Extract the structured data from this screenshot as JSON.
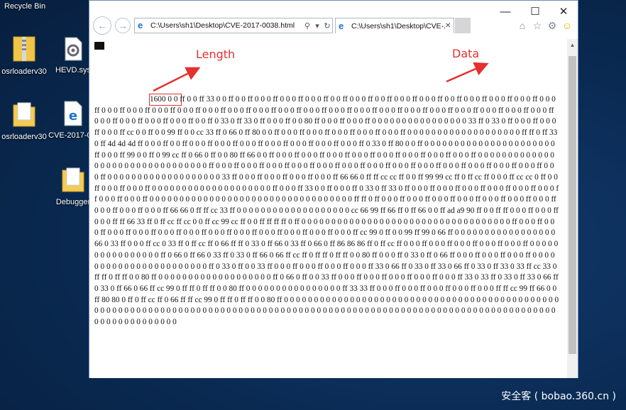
{
  "desktop": {
    "recycle_bin": "Recycle Bin",
    "icons": [
      {
        "label": "osrloaderv30",
        "icon": "zip-folder-icon"
      },
      {
        "label": "HEVD.sys",
        "icon": "system-file-icon"
      },
      {
        "label": "osrloaderv30",
        "icon": "folder-icon"
      },
      {
        "label": "CVE-2017-0...",
        "icon": "ie-file-icon"
      },
      {
        "label": "Debugger",
        "icon": "folder-icon"
      }
    ],
    "watermark": "安全客 ( bobao.360.cn )"
  },
  "browser": {
    "address": "C:\\Users\\sh1\\Desktop\\CVE-2017-0038.html",
    "tab_title": "C:\\Users\\sh1\\Desktop\\CVE-...",
    "window_controls": {
      "minimize": "—",
      "maximize": "☐",
      "close": "✕"
    },
    "toolbar_icons": [
      "home-icon",
      "favorites-star-icon",
      "settings-gear-icon",
      "feedback-smiley-icon"
    ]
  },
  "annotations": {
    "length_label": "Length",
    "data_label": "Data",
    "color": "#e5302c"
  },
  "dump": {
    "length_value": "1600",
    "text": "0 0 ff 0 0 ff 33 0 0 ff 0 0 ff 0 0 0 ff 0 0 0 ff 0 0 0 ff 0 0 ff 0 0 0 ff 0 0 ff 0 0 0 ff 0 0 0 ff 0 0 ff 0 0 0 ff 0 0 0 ff 0 0 0 ff 0 0 0 ff 0 0 0 ff 0 0 0 ff 0 0 0 ff 0 0 0 ff 0 0 0 ff 0 0 0 ff 0 0 0 ff 0 0 0 ff 0 0 0 ff 0 0 0 ff 0 0 0 ff 0 0 0 ff 0 0 0 ff 0 0 0 ff 0 0 0 ff 0 0 0 ff 0 0 0 ff 0 0 0 ff 0 0 0 ff 0 0 0 ff 0 0 0 ff 0 0 0 ff 0 0 ff 0 33 0 ff 33 0 ff 0 0 0 ff 0 0 80 ff 0 0 0 ff 0 0 0 ff 0 0 0 0 0 0 0 0 0 0 0 0 0 0 0 0 33 ff 0 33 0 ff 0 0 0 ff 0 0 0 ff 0 0 0 ff cc 0 0 ff 0 0 99 ff 0 0 cc 33 ff 0 66 0 ff 80 0 0 ff 0 0 0 ff 0 0 0 ff 0 0 0 ff 0 0 0 ff 0 0 0 ff 0 0 0 0 0 0 0 0 0 0 0 0 0 0 0 0 0 0 0 ff ff 0 ff 33 0 ff 4d 4d 4d ff 0 0 0 ff 0 0 ff 0 0 0 ff 0 0 0 ff 0 0 0 ff 0 0 0 ff 0 0 0 ff 0 0 0 ff 0 0 0 ff 0 33 0 ff 80 0 0 ff 0 0 0 0 0 0 0 0 0 0 0 0 0 0 0 0 0 0 0 0 0 0 ff 0 0 0 ff 99 0 0 ff 0 99 cc ff 0 66 0 ff 0 0 80 ff 66 0 0 ff 0 0 0 ff 0 0 0 ff 0 0 0 ff 0 0 0 ff 0 0 0 ff 0 0 0 ff 0 0 0 ff 0 0 0 ff 0 0 0 0 0 0 0 0 0 0 0 0 0 0 0 0 0 0 0 0 0 0 0 0 0 0 0 0 0 0 0 0 ff 0 0 0 ff 0 0 0 ff 0 0 0 ff 0 0 0 ff 0 0 0 ff 0 0 0 ff 0 0 0 ff 0 0 0 ff 0 0 0 ff 0 0 0 ff 0 0 0 ff 0 0 0 ff 0 0 0 ff 0 0 0 ff 0 0 0 0 0 0 0 0 0 0 0 0 0 0 0 0 0 0 0 33 ff 0 0 0 ff 0 0 0 ff 0 0 0 ff 0 0 0 ff 66 66 0 ff ff cc cc ff 0 0 ff 99 99 cc ff 0 ff cc ff 0 0 0 ff cc cc 0 ff 0 0 ff 0 0 0 ff 0 0 0 ff 0 0 0 0 0 0 0 0 0 0 0 0 0 0 0 0 0 0 0 0 ff 0 0 0 ff 33 0 0 ff 0 0 0 ff 0 33 0 ff 33 0 ff 0 0 0 ff 0 0 0 ff 0 0 0 ff 0 0 0 ff 0 0 0 ff 0 0 0 ff 0 0 0 ff 0 0 0 ff 0 0 0 0 0 0 0 0 0 0 0 0 0 0 0 0 0 0 0 0 0 0 0 0 0 0 0 0 0 0 0 0 0 0 ff ff 0 ff 0 0 0 ff 0 0 0 ff 0 0 0 ff 0 0 0 ff 0 0 0 ff 0 0 0 ff 0 0 0 ff 0 0 0 ff 0 0 0 ff 0 0 0 ff 66 66 0 ff ff cc 33 ff 0 0 0 0 0 0 0 0 0 0 0 0 0 0 0 0 0 0 0 cc 66 99 ff 66 ff 0 ff 66 0 0 ff ad a9 90 ff 0 0 ff ff 0 0 0 ff 0 0 0 ff 0 0 0 ff ff 66 33 ff 0 ff cc ff cc 0 0 ff cc 99 cc ff 0 0 ff ff ff ff 0 ff 0 0 0 0 0 0 0 0 0 0 0 0 0 0 0 0 0 0 0 0 0 0 0 0 0 0 0 0 0 0 0 0 0 0 0 ff 0 0 0 ff 0 0 0 ff 0 0 0 ff 0 0 0 ff 0 0 0 ff 0 0 0 ff 0 0 0 ff 0 0 0 ff 0 0 0 ff 0 0 0 ff 0 0 0 ff 0 0 0 ff cc 99 0 ff 0 0 99 ff 99 0 66 ff 0 0 0 0 0 0 0 0 0 0 0 0 0 0 0 0 0 66 0 33 ff 0 0 0 ff cc 0 33 ff 0 ff cc ff 0 66 ff ff 0 33 0 ff 66 0 33 ff 0 66 0 ff 86 86 86 ff 0 ff cc ff 0 0 0 ff 0 0 0 ff 0 0 0 ff 0 0 0 ff 0 0 0 ff 0 0 0 0 0 0 0 0 0 0 0 0 0 0 0 0 ff 0 66 0 ff 66 0 33 ff 0 33 0 ff 66 0 66 ff cc ff 0 ff ff 0 ff ff 0 0 80 ff 0 0 0 ff 0 33 0 ff 0 66 ff 0 0 0 ff 0 0 0 ff 0 0 0 ff 0 0 0 0 0 0 0 0 0 0 0 0 0 0 0 0 0 0 0 0 0 0 0 ff 0 33 0 ff 0 0 33 ff 0 0 0 ff 0 0 0 ff 0 0 0 ff 0 0 0 ff 33 0 66 ff 0 33 0 ff 33 0 66 ff 0 33 0 ff 33 0 33 ff cc 33 0 ff ff 0 ff ff 0 0 80 ff 0 0 0 0 0 0 0 0 0 0 0 0 0 0 0 0 0 0 0 ff 0 66 0 ff 0 0 33 ff 0 0 0 ff 0 0 0 ff 0 0 0 ff 0 0 0 ff 0 0 0 ff 33 0 33 ff 0 33 0 ff 33 0 66 ff 0 33 0 ff 66 0 66 ff cc 99 0 ff ff 0 ff ff 0 0 80 ff 0 0 0 0 0 0 0 0 0 0 0 0 0 0 0 0 ff 33 33 ff 0 0 0 ff 0 0 0 ff 0 0 0 ff 0 0 0 ff 0 0 0 ff ff cc 99 ff 66 0 0 ff 80 80 0 ff 0 ff cc ff 0 66 ff ff cc 99 0 ff ff 0 ff ff 0 0 80 ff 0 0 0 0 0 0 0 0 0 0 0 0 0 0 0 0 0 0 0 0 0 0 0 0 0 0 0 0 0 0 0 0 0 0 0 0 0 0 0 0 0 0 0 0 0 0 0 0 0 0 0 0 0 0 0 0 0 0 0 0 0 0 0 0 0 0 0 0 0 0 0 0 0 0 0 0 0 0 0 0 0 0 0 0 0 0 0 0 0 0 0 0 0 0 0 0 0 0 0 0 0 0 0 0 0 0 0 0 0 0 0 0 0 0 0 0 0 0 0 0 0 0 0 0 0 0 0 0 0 0 0 0 0 0 0 0 0"
  }
}
